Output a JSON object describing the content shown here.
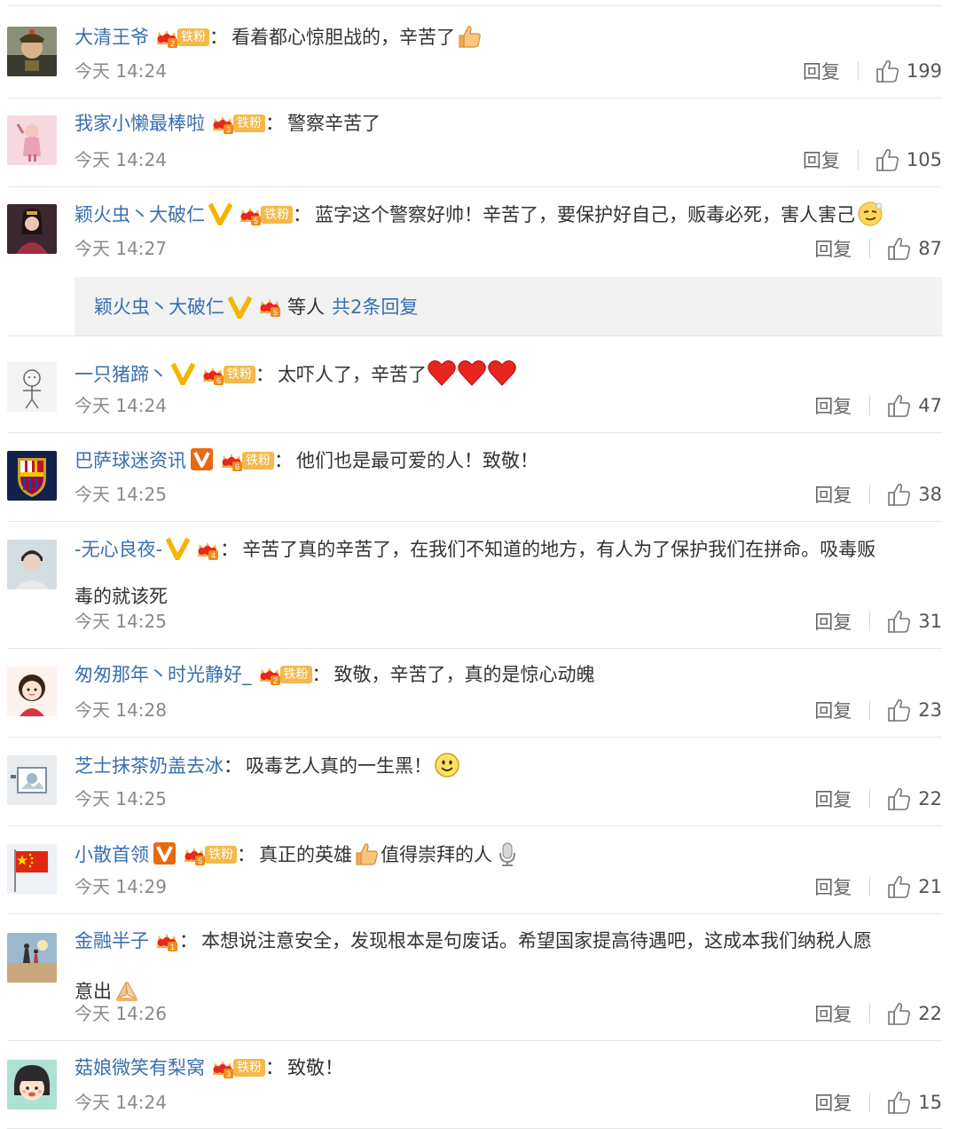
{
  "ui": {
    "reply_label": "回复",
    "fan_label": "铁粉"
  },
  "sub_reply": {
    "name": "颖火虫丶大破仁",
    "suffix": "等人",
    "more": "共2条回复",
    "crown_level": "5"
  },
  "comments": [
    {
      "name": "大清王爷",
      "badge_level": "2",
      "fan": true,
      "vip": "",
      "text": "看着都心惊胆战的，辛苦了",
      "emoji": "thumbs-up",
      "time": "今天 14:24",
      "likes": "199",
      "avatar": "qing-official"
    },
    {
      "name": "我家小懒最棒啦",
      "badge_level": "3",
      "fan": true,
      "vip": "",
      "text": "警察辛苦了",
      "emoji": "",
      "time": "今天 14:24",
      "likes": "105",
      "avatar": "pink-girl"
    },
    {
      "name": "颖火虫丶大破仁",
      "badge_level": "5",
      "fan": true,
      "vip": "yellow",
      "text": "蓝字这个警察好帅！辛苦了，要保护好自己，贩毒必死，害人害己",
      "emoji": "smug",
      "time": "今天 14:27",
      "likes": "87",
      "avatar": "costume"
    },
    {
      "name": "一只猪蹄丶",
      "badge_level": "6",
      "fan": true,
      "vip": "yellow",
      "text": "太吓人了，辛苦了",
      "emoji": "hearts",
      "time": "今天 14:24",
      "likes": "47",
      "avatar": "sketch"
    },
    {
      "name": "巴萨球迷资讯",
      "badge_level": "6",
      "fan": true,
      "vip": "orange",
      "text": "他们也是最可爱的人！致敬！",
      "emoji": "",
      "time": "今天 14:25",
      "likes": "38",
      "avatar": "barca"
    },
    {
      "name": "-无心良夜-",
      "badge_level": "4",
      "fan": false,
      "vip": "yellow",
      "text": "辛苦了真的辛苦了，在我们不知道的地方，有人为了保护我们在拼命。吸毒贩",
      "text2": "毒的就该死",
      "emoji": "",
      "time": "今天 14:25",
      "likes": "31",
      "avatar": "young-man"
    },
    {
      "name": "匆匆那年丶时光静好_",
      "badge_level": "2",
      "fan": true,
      "vip": "",
      "text": "致敬，辛苦了，真的是惊心动魄",
      "emoji": "",
      "time": "今天 14:28",
      "likes": "23",
      "avatar": "cartoon-girl"
    },
    {
      "name": "芝士抹茶奶盖去冰",
      "badge_level": "",
      "fan": false,
      "vip": "",
      "text": "吸毒艺人真的一生黑！",
      "emoji": "smile",
      "time": "今天 14:25",
      "likes": "22",
      "avatar": "drawing"
    },
    {
      "name": "小散首领",
      "badge_level": "5",
      "fan": true,
      "vip": "orange",
      "text": "真正的英雄",
      "text_after": "值得崇拜的人",
      "emoji": "thumbs-up",
      "emoji2": "microphone",
      "time": "今天 14:29",
      "likes": "21",
      "avatar": "flag"
    },
    {
      "name": "金融半子",
      "badge_level": "1",
      "fan": false,
      "vip": "",
      "text": "本想说注意安全，发现根本是句废话。希望国家提高待遇吧，这成本我们纳税人愿",
      "text2": "意出",
      "emoji2": "pray",
      "time": "今天 14:26",
      "likes": "22",
      "avatar": "beach"
    },
    {
      "name": "菇娘微笑有梨窝",
      "badge_level": "3",
      "fan": true,
      "vip": "",
      "text": "致敬！",
      "emoji": "",
      "time": "今天 14:24",
      "likes": "15",
      "avatar": "maruko"
    }
  ],
  "colors": {
    "link": "#3a6fb0",
    "fan_tag": "#f5b84a",
    "vip_yellow": "#f5b400",
    "vip_orange": "#e86a10",
    "heart": "#e8251f"
  }
}
